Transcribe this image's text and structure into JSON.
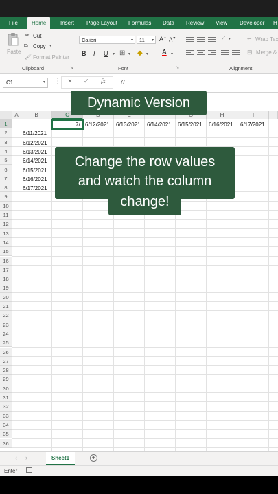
{
  "ribbon_tabs": [
    "File",
    "Home",
    "Insert",
    "Page Layout",
    "Formulas",
    "Data",
    "Review",
    "View",
    "Developer",
    "H"
  ],
  "active_tab": "Home",
  "clipboard": {
    "paste": "Paste",
    "cut": "Cut",
    "copy": "Copy",
    "format_painter": "Format Painter",
    "label": "Clipboard"
  },
  "font": {
    "name": "Calibri",
    "size": "11",
    "label": "Font",
    "bold": "B",
    "italic": "I",
    "underline": "U",
    "font_color_glyph": "A"
  },
  "alignment": {
    "wrap_text": "Wrap Tex",
    "merge": "Merge &",
    "label": "Alignment"
  },
  "formula_bar": {
    "name_box": "C1",
    "cancel": "×",
    "enter": "✓",
    "fx": "fx",
    "content": "7/"
  },
  "columns": [
    "A",
    "B",
    "C",
    "D",
    "E",
    "F",
    "G",
    "H",
    "I"
  ],
  "rows": [
    "1",
    "2",
    "3",
    "4",
    "5",
    "6",
    "7",
    "8",
    "9",
    "10",
    "11",
    "12",
    "13",
    "14",
    "15",
    "16",
    "17",
    "18",
    "19",
    "20",
    "21",
    "22",
    "23",
    "24",
    "25",
    "26",
    "27",
    "28",
    "29",
    "30",
    "31",
    "32",
    "33",
    "34",
    "35",
    "36"
  ],
  "active_cell_text": "7/",
  "row1_dates": [
    "6/12/2021",
    "6/13/2021",
    "6/14/2021",
    "6/15/2021",
    "6/16/2021",
    "6/17/2021"
  ],
  "colB_dates": [
    "6/11/2021",
    "6/12/2021",
    "6/13/2021",
    "6/14/2021",
    "6/15/2021",
    "6/16/2021",
    "6/17/2021"
  ],
  "sheet": {
    "name": "Sheet1",
    "add": "+",
    "prev": "‹",
    "next": "›"
  },
  "status": {
    "mode": "Enter"
  },
  "overlays": {
    "top": "Dynamic Version",
    "middle_line1": "Change the row values",
    "middle_line2": "and watch the column",
    "middle_line3": "change!"
  },
  "colors": {
    "excel_green": "#217346",
    "overlay_green": "#2e5a3d"
  }
}
